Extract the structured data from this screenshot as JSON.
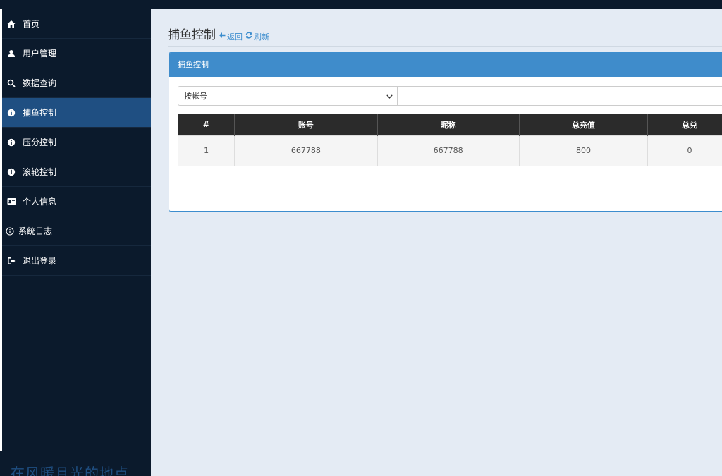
{
  "sidebar": {
    "items": [
      {
        "label": "首页",
        "icon": "home-icon"
      },
      {
        "label": "用户管理",
        "icon": "user-icon"
      },
      {
        "label": "数据查询",
        "icon": "search-icon"
      },
      {
        "label": "捕鱼控制",
        "icon": "info-circle-icon",
        "active": true
      },
      {
        "label": "压分控制",
        "icon": "info-circle-icon"
      },
      {
        "label": "滚轮控制",
        "icon": "info-circle-icon"
      },
      {
        "label": "个人信息",
        "icon": "id-card-icon"
      },
      {
        "label": "系统日志",
        "icon": "info-outline-icon"
      },
      {
        "label": "退出登录",
        "icon": "sign-out-icon"
      }
    ],
    "footer_text": "在风暖且光的地点"
  },
  "header": {
    "title": "捕鱼控制",
    "back_label": "返回",
    "refresh_label": "刷新"
  },
  "panel": {
    "heading": "捕鱼控制",
    "filter": {
      "selected": "按帐号",
      "input_value": ""
    },
    "table": {
      "columns": [
        "#",
        "账号",
        "昵称",
        "总充值",
        "总兑"
      ],
      "rows": [
        [
          "1",
          "667788",
          "667788",
          "800",
          "0"
        ]
      ]
    }
  },
  "colors": {
    "sidebar_bg": "#0b1a2c",
    "active_item": "#1f4f82",
    "accent": "#3f8ccb",
    "page_bg": "#e4ebf4",
    "table_header": "#2b2b2b"
  }
}
